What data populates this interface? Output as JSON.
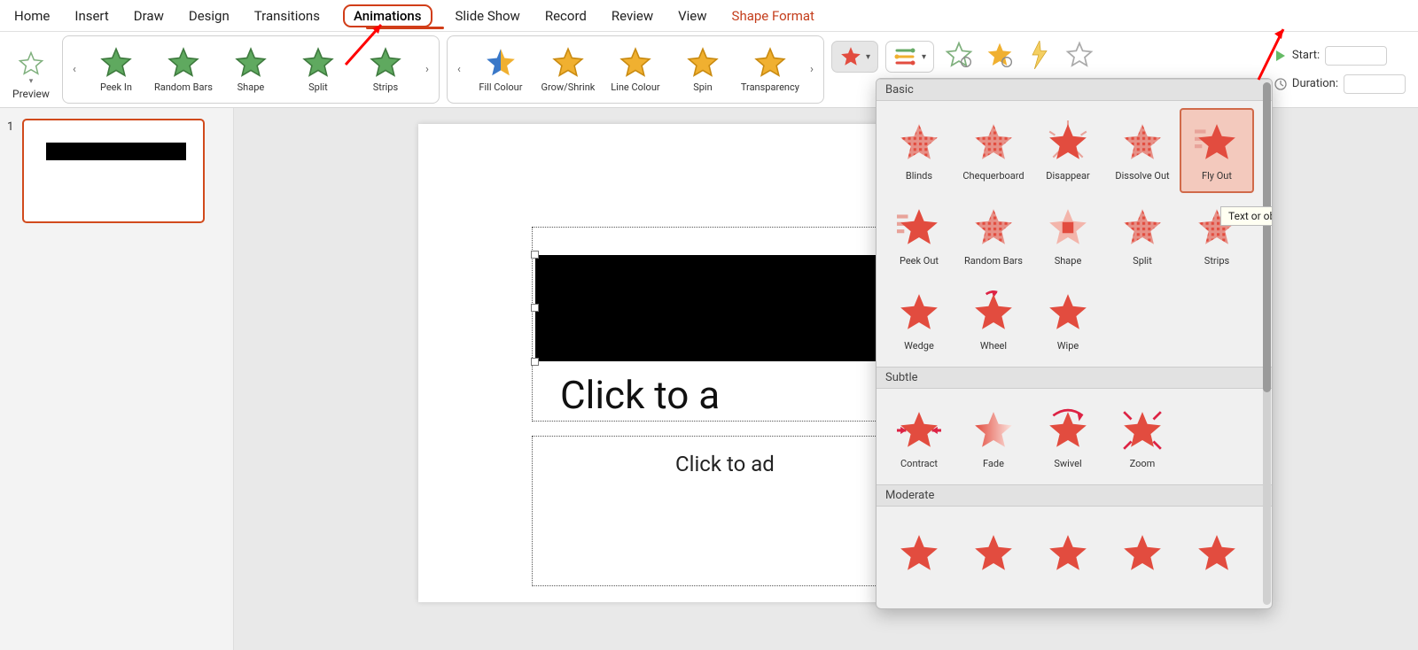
{
  "tabs": {
    "home": "Home",
    "insert": "Insert",
    "draw": "Draw",
    "design": "Design",
    "transitions": "Transitions",
    "animations": "Animations",
    "slideshow": "Slide Show",
    "record": "Record",
    "review": "Review",
    "view": "View",
    "shape_format": "Shape Format"
  },
  "toolbar": {
    "preview": "Preview",
    "entrance_gallery": [
      {
        "label": "Peek In"
      },
      {
        "label": "Random Bars"
      },
      {
        "label": "Shape"
      },
      {
        "label": "Split"
      },
      {
        "label": "Strips"
      }
    ],
    "emphasis_gallery": [
      {
        "label": "Fill Colour"
      },
      {
        "label": "Grow/Shrink"
      },
      {
        "label": "Line Colour"
      },
      {
        "label": "Spin"
      },
      {
        "label": "Transparency"
      }
    ],
    "start_label": "Start:",
    "duration_label": "Duration:"
  },
  "slide": {
    "number": "1",
    "title_placeholder": "Click to a",
    "subtitle_placeholder": "Click to ad"
  },
  "exit_panel": {
    "sections": {
      "basic": {
        "header": "Basic",
        "items": [
          "Blinds",
          "Chequerboard",
          "Disappear",
          "Dissolve Out",
          "Fly Out",
          "Peek Out",
          "Random Bars",
          "Shape",
          "Split",
          "Strips",
          "Wedge",
          "Wheel",
          "Wipe"
        ]
      },
      "subtle": {
        "header": "Subtle",
        "items": [
          "Contract",
          "Fade",
          "Swivel",
          "Zoom"
        ]
      },
      "moderate": {
        "header": "Moderate",
        "items": [
          "",
          "",
          "",
          "",
          ""
        ]
      }
    },
    "selected": "Fly Out",
    "tooltip": "Text or object flies away in a sp"
  }
}
